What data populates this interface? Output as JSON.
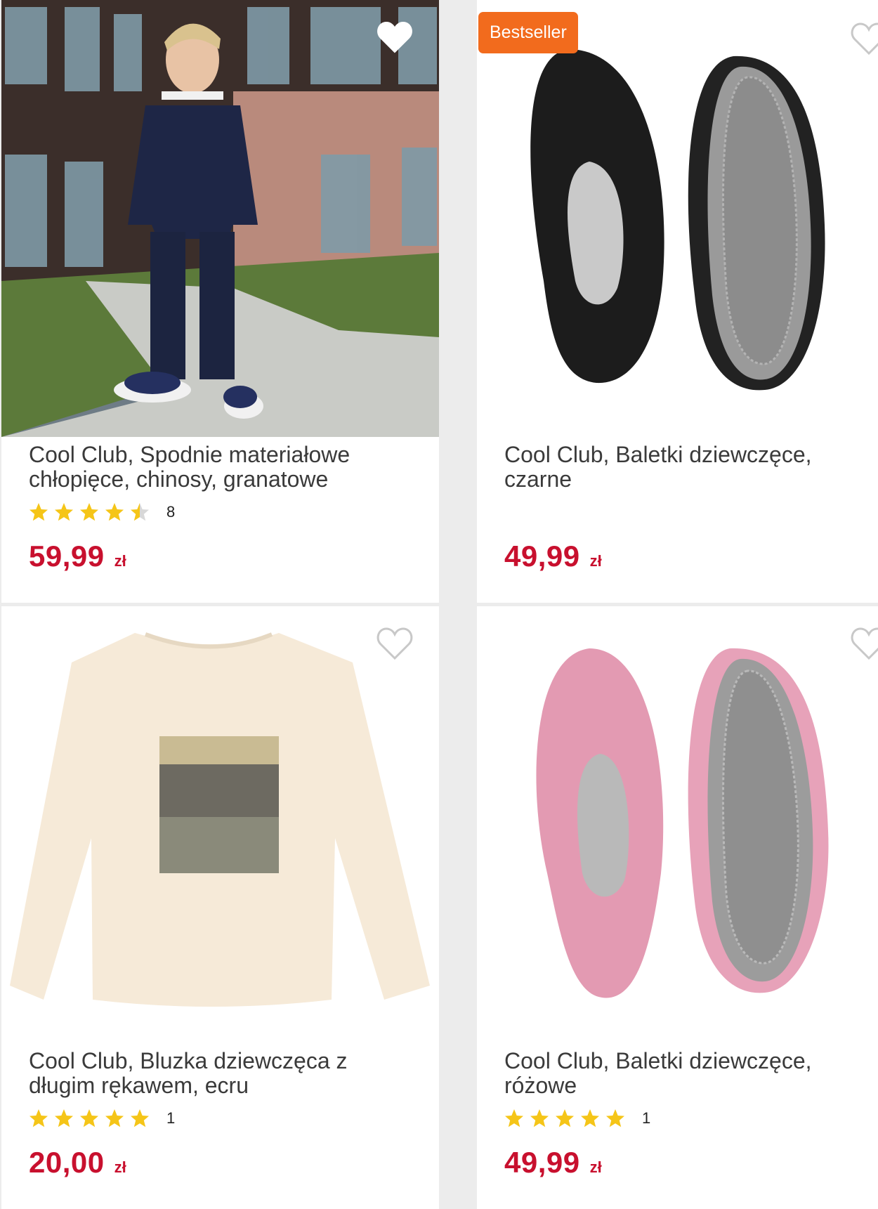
{
  "products": [
    {
      "title_line1": "Cool Club, Spodnie materiałowe",
      "title_line2": "chłopięce, chinosy, granatowe",
      "rating_count": "8",
      "rating_value": 4.5,
      "price": "59,99",
      "currency": "zł"
    },
    {
      "badge": "Bestseller",
      "title_line1": "Cool Club, Baletki dziewczęce,",
      "title_line2": "czarne",
      "price": "49,99",
      "currency": "zł"
    },
    {
      "title_line1": "Cool Club, Bluzka dziewczęca z",
      "title_line2": "długim rękawem, ecru",
      "rating_count": "1",
      "rating_value": 5,
      "price": "20,00",
      "currency": "zł"
    },
    {
      "title_line1": "Cool Club, Baletki dziewczęce,",
      "title_line2": "różowe",
      "rating_count": "1",
      "rating_value": 5,
      "price": "49,99",
      "currency": "zł"
    }
  ],
  "colors": {
    "price": "#c8102e",
    "star": "#f5c518",
    "badge": "#f26b1d"
  },
  "icons": {
    "favorite": "heart-outline-icon",
    "rating": "star-icon"
  }
}
